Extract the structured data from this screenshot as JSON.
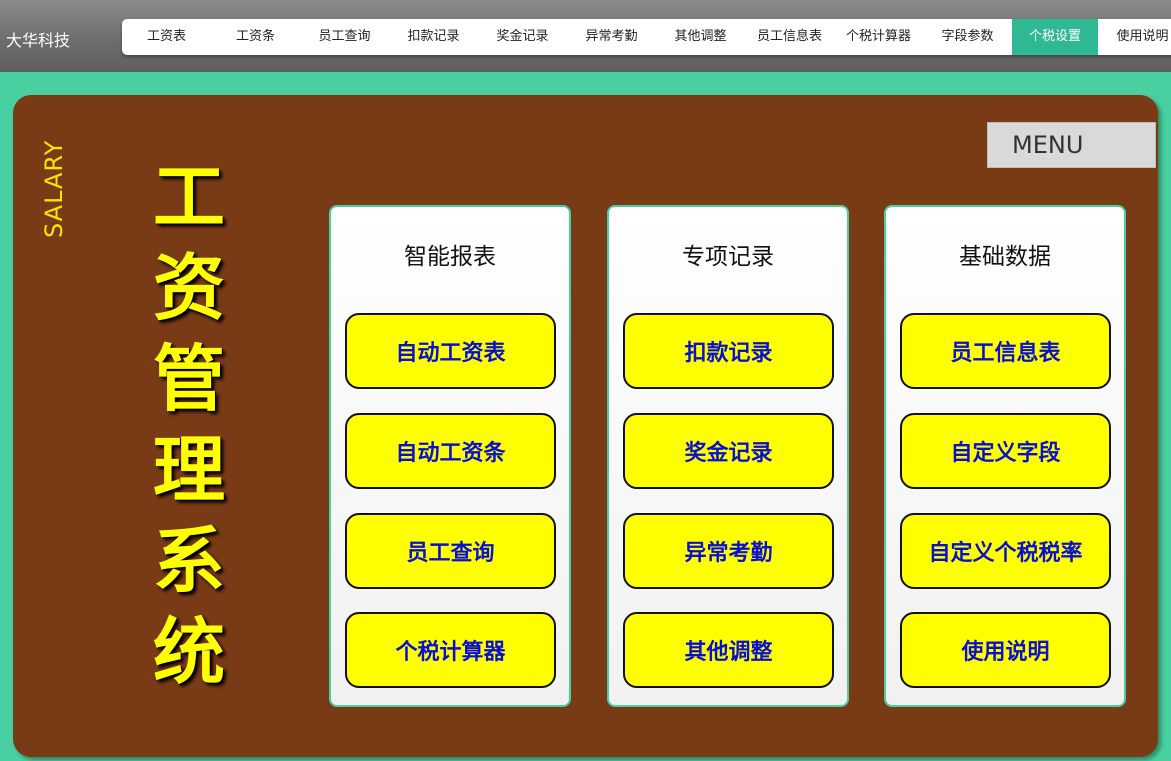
{
  "brand": "大华科技",
  "nav": {
    "tabs": [
      {
        "label": "工资表"
      },
      {
        "label": "工资条"
      },
      {
        "label": "员工查询"
      },
      {
        "label": "扣款记录"
      },
      {
        "label": "奖金记录"
      },
      {
        "label": "异常考勤"
      },
      {
        "label": "其他调整"
      },
      {
        "label": "员工信息表"
      },
      {
        "label": "个税计算器"
      },
      {
        "label": "字段参数"
      },
      {
        "label": "个税设置"
      },
      {
        "label": "使用说明"
      }
    ],
    "active_tab": "个税设置"
  },
  "side": {
    "salary_label": "SALARY",
    "title_chars": [
      "工",
      "资",
      "管",
      "理",
      "系",
      "统"
    ]
  },
  "menu_label": "MENU",
  "columns": [
    {
      "title": "智能报表",
      "buttons": [
        "自动工资表",
        "自动工资条",
        "员工查询",
        "个税计算器"
      ]
    },
    {
      "title": "专项记录",
      "buttons": [
        "扣款记录",
        "奖金记录",
        "异常考勤",
        "其他调整"
      ]
    },
    {
      "title": "基础数据",
      "buttons": [
        "员工信息表",
        "自定义字段",
        "自定义个税税率",
        "使用说明"
      ]
    }
  ],
  "colors": {
    "background": "#49cfa0",
    "panel": "#793a16",
    "button": "#ffff00",
    "button_text": "#0a10d0",
    "active_tab": "#2fb894",
    "title": "#ffff00"
  }
}
